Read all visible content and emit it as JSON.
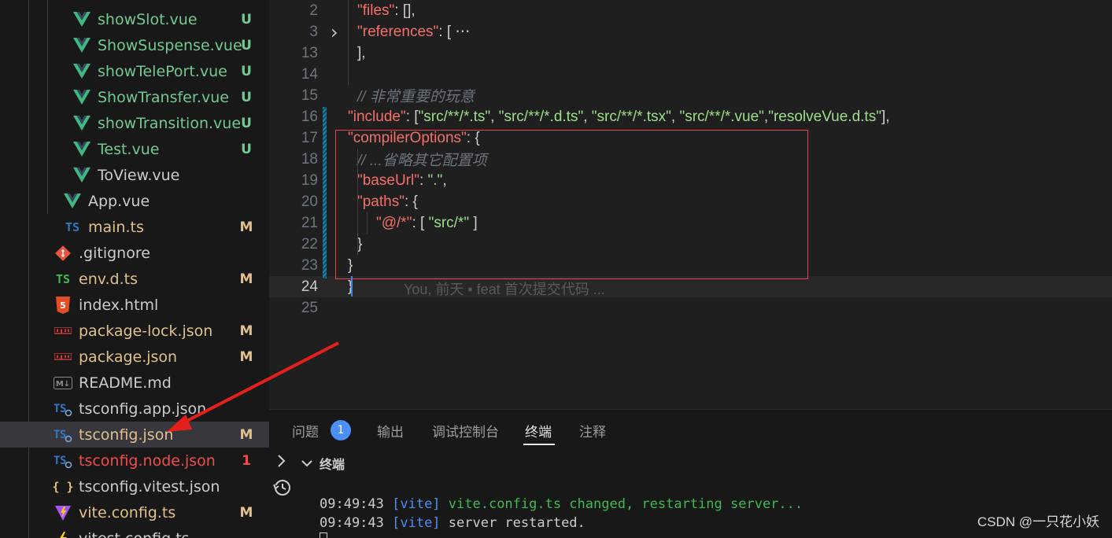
{
  "explorer": {
    "files": [
      {
        "name": "showSlot.vue",
        "icon": "vue-icon",
        "status": "U",
        "tone": "added",
        "indent": 1
      },
      {
        "name": "ShowSuspense.vue",
        "icon": "vue-icon",
        "status": "U",
        "tone": "added",
        "indent": 1
      },
      {
        "name": "showTelePort.vue",
        "icon": "vue-icon",
        "status": "U",
        "tone": "added",
        "indent": 1
      },
      {
        "name": "ShowTransfer.vue",
        "icon": "vue-icon",
        "status": "U",
        "tone": "added",
        "indent": 1
      },
      {
        "name": "showTransition.vue",
        "icon": "vue-icon",
        "status": "U",
        "tone": "added",
        "indent": 1
      },
      {
        "name": "Test.vue",
        "icon": "vue-icon",
        "status": "U",
        "tone": "added",
        "indent": 1
      },
      {
        "name": "ToView.vue",
        "icon": "vue-icon",
        "status": "",
        "tone": "plain",
        "indent": 1
      },
      {
        "name": "App.vue",
        "icon": "vue-icon",
        "status": "",
        "tone": "plain",
        "indent": 0
      },
      {
        "name": "main.ts",
        "icon": "ts-icon",
        "status": "M",
        "tone": "mod",
        "indent": 0
      },
      {
        "name": ".gitignore",
        "icon": "git-icon",
        "status": "",
        "tone": "plain",
        "indent": -1
      },
      {
        "name": "env.d.ts",
        "icon": "ts-green-icon",
        "status": "M",
        "tone": "mod",
        "indent": -1
      },
      {
        "name": "index.html",
        "icon": "html-icon",
        "status": "",
        "tone": "plain",
        "indent": -1
      },
      {
        "name": "package-lock.json",
        "icon": "npm-icon",
        "status": "M",
        "tone": "mod",
        "indent": -1
      },
      {
        "name": "package.json",
        "icon": "npm-icon",
        "status": "M",
        "tone": "mod",
        "indent": -1
      },
      {
        "name": "README.md",
        "icon": "markdown-icon",
        "status": "",
        "tone": "plain",
        "indent": -1
      },
      {
        "name": "tsconfig.app.json",
        "icon": "tsconfig-icon",
        "status": "",
        "tone": "plain",
        "indent": -1
      },
      {
        "name": "tsconfig.json",
        "icon": "tsconfig-icon",
        "status": "M",
        "tone": "mod",
        "indent": -1,
        "selected": true
      },
      {
        "name": "tsconfig.node.json",
        "icon": "tsconfig-icon",
        "status": "1",
        "tone": "err",
        "indent": -1
      },
      {
        "name": "tsconfig.vitest.json",
        "icon": "json-icon",
        "status": "",
        "tone": "plain",
        "indent": -1
      },
      {
        "name": "vite.config.ts",
        "icon": "vite-icon",
        "status": "M",
        "tone": "mod",
        "indent": -1
      },
      {
        "name": "vitest.config.ts",
        "icon": "vitest-icon",
        "status": "",
        "tone": "plain",
        "indent": -1
      }
    ]
  },
  "editor": {
    "lines": [
      {
        "n": "2",
        "segments": [
          [
            "k",
            "\"files\""
          ],
          [
            "p",
            ": [],"
          ]
        ],
        "indent": 1
      },
      {
        "n": "3",
        "segments": [
          [
            "k",
            "\"references\""
          ],
          [
            "p",
            ": [ "
          ],
          [
            "p",
            "⋯"
          ]
        ],
        "indent": 1,
        "folded": true
      },
      {
        "n": "13",
        "segments": [
          [
            "p",
            "],"
          ]
        ],
        "indent": 1
      },
      {
        "n": "14",
        "segments": [],
        "indent": 1
      },
      {
        "n": "15",
        "segments": [
          [
            "c",
            "// 非常重要的玩意"
          ]
        ],
        "indent": 1
      },
      {
        "n": "16",
        "segments": [
          [
            "k",
            "\"include\""
          ],
          [
            "p",
            ": ["
          ],
          [
            "s",
            "\"src/**/*.ts\""
          ],
          [
            "p",
            ", "
          ],
          [
            "s",
            "\"src/**/*.d.ts\""
          ],
          [
            "p",
            ", "
          ],
          [
            "s",
            "\"src/**/*.tsx\""
          ],
          [
            "p",
            ", "
          ],
          [
            "s",
            "\"src/**/*.vue\""
          ],
          [
            "p",
            ","
          ],
          [
            "s",
            "\"resolveVue.d.ts\""
          ],
          [
            "p",
            "],"
          ]
        ],
        "indent": 0
      },
      {
        "n": "17",
        "segments": [
          [
            "k",
            "\"compilerOptions\""
          ],
          [
            "p",
            ": {"
          ]
        ],
        "indent": 0
      },
      {
        "n": "18",
        "segments": [
          [
            "c",
            "// ...省略其它配置项"
          ]
        ],
        "indent": 1
      },
      {
        "n": "19",
        "segments": [
          [
            "k",
            "\"baseUrl\""
          ],
          [
            "p",
            ": "
          ],
          [
            "s",
            "\".\""
          ],
          [
            "p",
            ","
          ]
        ],
        "indent": 1
      },
      {
        "n": "20",
        "segments": [
          [
            "k",
            "\"paths\""
          ],
          [
            "p",
            ": {"
          ]
        ],
        "indent": 1
      },
      {
        "n": "21",
        "segments": [
          [
            "k",
            "\"@/*\""
          ],
          [
            "p",
            ": [ "
          ],
          [
            "s",
            "\"src/*\""
          ],
          [
            "p",
            " ]"
          ]
        ],
        "indent": 2
      },
      {
        "n": "22",
        "segments": [
          [
            "p",
            "}"
          ]
        ],
        "indent": 1
      },
      {
        "n": "23",
        "segments": [
          [
            "p",
            "}"
          ]
        ],
        "indent": 0
      },
      {
        "n": "24",
        "segments": [
          [
            "p",
            "}"
          ]
        ],
        "indent": -1,
        "current": true
      },
      {
        "n": "25",
        "segments": [],
        "indent": -1
      }
    ],
    "blame": "You, 前天 • feat 首次提交代码 ..."
  },
  "panel": {
    "tabs": [
      {
        "label": "问题",
        "name": "tab-problems"
      },
      {
        "label": "输出",
        "name": "tab-output"
      },
      {
        "label": "调试控制台",
        "name": "tab-debug-console"
      },
      {
        "label": "终端",
        "name": "tab-terminal",
        "active": true
      },
      {
        "label": "注释",
        "name": "tab-comments"
      }
    ],
    "problems_count": "1",
    "terminal_title": "终端",
    "terminal_lines": [
      {
        "time": "09:49:43",
        "tag": "[vite]",
        "msg": "vite.config.ts changed, restarting server...",
        "msg_green": true
      },
      {
        "time": "09:49:43",
        "tag": "[vite]",
        "msg": "server restarted.",
        "msg_green": false
      }
    ]
  },
  "watermark": "CSDN @一只花小妖",
  "colors": {
    "accent": "#4c8ff6",
    "modified": "#e2c08d",
    "untracked": "#73c991",
    "error": "#f14c4c",
    "highlight_box": "#e8444c",
    "arrow": "#e5201b"
  }
}
